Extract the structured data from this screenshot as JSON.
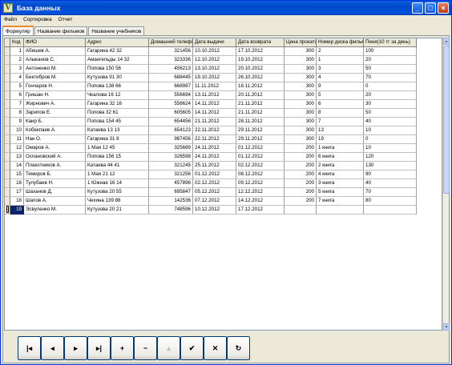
{
  "window": {
    "title": "База данных",
    "icon_letter": "V",
    "buttons": {
      "minimize": "_",
      "maximize": "□",
      "close": "×"
    }
  },
  "menu": [
    "Файл",
    "Сортировка",
    "Отчет"
  ],
  "tabs": [
    {
      "label": "Формуляр",
      "active": true
    },
    {
      "label": "Название фильмов",
      "active": false
    },
    {
      "label": "Название учебников",
      "active": false
    }
  ],
  "grid": {
    "columns": [
      "Код",
      "ФИО",
      "Адрес",
      "Домашний телефон",
      "Дата выдачи",
      "Дата возврата",
      "Цена проката",
      "Номер диска фильма",
      "Пеня(10 тг за день)"
    ],
    "rows": [
      [
        "1",
        "Абишев А.",
        "Гагарина 42 32",
        "321456",
        "10.10.2012",
        "17.10.2012",
        "300",
        "2",
        "100"
      ],
      [
        "2",
        "Алыканов С.",
        "Амангельды 14 32",
        "323336",
        "12.10.2012",
        "19.10.2012",
        "300",
        "1",
        "20"
      ],
      [
        "3",
        "Антоненко М.",
        "Попова 150 56",
        "456213",
        "13.10.2012",
        "20.10.2012",
        "300",
        "3",
        "50"
      ],
      [
        "4",
        "Бектибров М.",
        "Кутузова 91 30",
        "688445",
        "19.10.2012",
        "26.10.2012",
        "300",
        "4",
        "70"
      ],
      [
        "5",
        "Гончаров Н.",
        "Попова 138 66",
        "668987",
        "11.11.2012",
        "18.11.2012",
        "300",
        "9",
        "0"
      ],
      [
        "6",
        "Гришан Н.",
        "Чкалова 16 12",
        "556694",
        "13.11.2012",
        "20.11.2012",
        "300",
        "5",
        "20"
      ],
      [
        "7",
        "Жирнович А.",
        "Гагарина 32 16",
        "556624",
        "14.11.2012",
        "21.11.2012",
        "300",
        "6",
        "30"
      ],
      [
        "8",
        "Зарипов Е.",
        "Попова 32 61",
        "605605",
        "14.11.2012",
        "21.11.2012",
        "300",
        "8",
        "50"
      ],
      [
        "9",
        "Каир Б.",
        "Попова 154 45",
        "654456",
        "21.11.2012",
        "28.11.2012",
        "300",
        "7",
        "40"
      ],
      [
        "10",
        "Кобекпаев А.",
        "Катаева 13 13",
        "654123",
        "22.11.2012",
        "29.11.2012",
        "300",
        "13",
        "10"
      ],
      [
        "11",
        "Нан О.",
        "Гагарина 31 8",
        "987456",
        "22.11.2012",
        "29.11.2012",
        "300",
        "19",
        "0"
      ],
      [
        "12",
        "Омаров А.",
        "1 Мая 12 45",
        "325689",
        "24.11.2012",
        "01.12.2012",
        "200",
        "1 книга",
        "10"
      ],
      [
        "13",
        "Оспановский А.",
        "Попова 156 15",
        "326598",
        "24.11.2012",
        "01.12.2012",
        "200",
        "6 книга",
        "120"
      ],
      [
        "14",
        "Плакотников А.",
        "Катаева 44 41",
        "321245",
        "25.11.2012",
        "02.12.2012",
        "200",
        "2 книга",
        "130"
      ],
      [
        "15",
        "Темиров Б.",
        "1 Мая 21 12",
        "321256",
        "01.12.2012",
        "08.12.2012",
        "200",
        "4 книга",
        "90"
      ],
      [
        "16",
        "Тулубаев Н.",
        "1 Южная 16 14",
        "457896",
        "02.12.2012",
        "09.12.2012",
        "200",
        "3 книга",
        "40"
      ],
      [
        "17",
        "Шаханов Д.",
        "Кутузова 20 55",
        "695847",
        "05.12.2012",
        "12.12.2012",
        "200",
        "5 книга",
        "70"
      ],
      [
        "18",
        "Шапов А.",
        "Чехина 139 88",
        "142536",
        "07.12.2012",
        "14.12.2012",
        "200",
        "7 книга",
        "80"
      ],
      [
        "19",
        "Эсвуленко М.",
        "Кутузова 20 21",
        "748596",
        "10.12.2012",
        "17.12.2012",
        "",
        "",
        ""
      ]
    ],
    "current_row": 19
  },
  "navigator": [
    {
      "name": "first-record-button",
      "glyph": "|◂",
      "enabled": true
    },
    {
      "name": "prior-record-button",
      "glyph": "◂",
      "enabled": true
    },
    {
      "name": "next-record-button",
      "glyph": "▸",
      "enabled": true
    },
    {
      "name": "last-record-button",
      "glyph": "▸|",
      "enabled": true
    },
    {
      "name": "insert-record-button",
      "glyph": "+",
      "enabled": true
    },
    {
      "name": "delete-record-button",
      "glyph": "−",
      "enabled": true
    },
    {
      "name": "edit-record-button",
      "glyph": "▴",
      "enabled": false
    },
    {
      "name": "post-edit-button",
      "glyph": "✔",
      "enabled": true
    },
    {
      "name": "cancel-edit-button",
      "glyph": "✕",
      "enabled": true
    },
    {
      "name": "refresh-data-button",
      "glyph": "↻",
      "enabled": true
    }
  ]
}
